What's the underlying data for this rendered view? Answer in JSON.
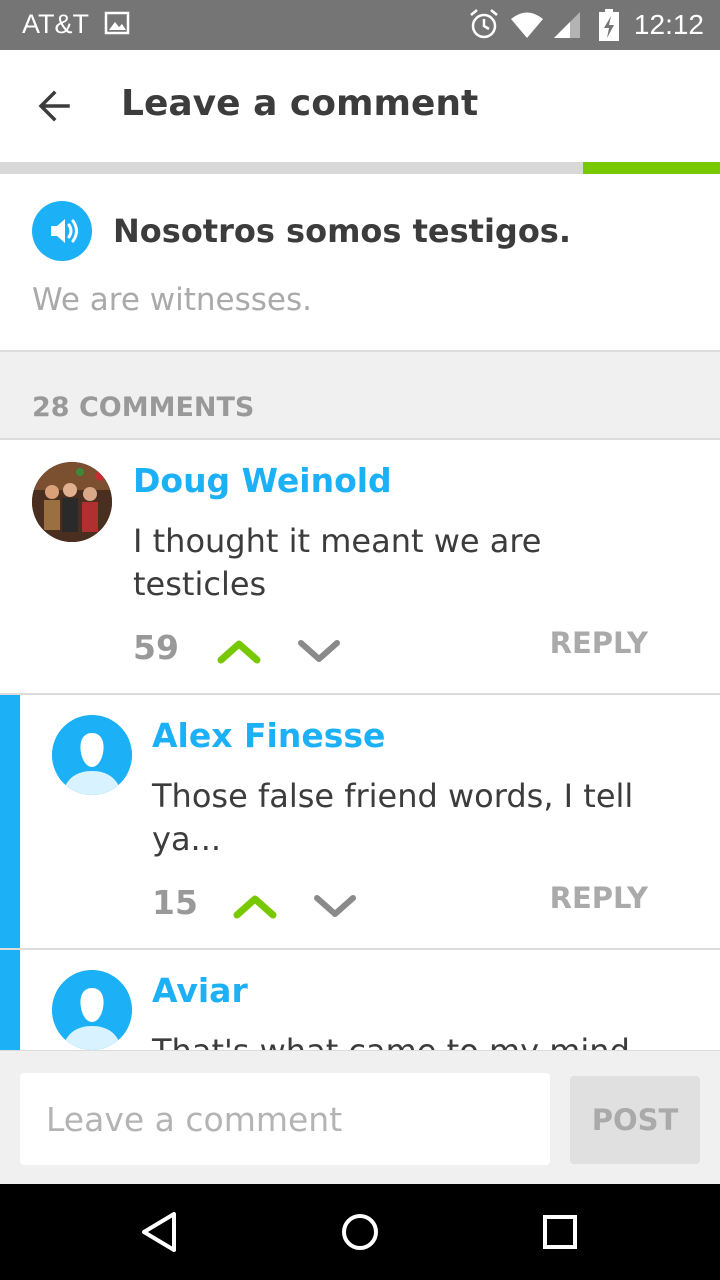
{
  "status_bar": {
    "carrier": "AT&T",
    "time": "12:12"
  },
  "header": {
    "title": "Leave a comment"
  },
  "lesson_progress": 0.19,
  "sentence": {
    "text": "Nosotros somos testigos.",
    "translation": "We are witnesses."
  },
  "comments_count": "28 COMMENTS",
  "comments": [
    {
      "author": "Doug Weinold",
      "text": "I thought it meant we are testicles",
      "votes": "59",
      "reply_label": "REPLY"
    },
    {
      "author": "Alex Finesse",
      "text": "Those false friend words, I tell ya...",
      "votes": "15",
      "reply_label": "REPLY"
    },
    {
      "author": "Aviar",
      "text": "That's what came to my mind"
    }
  ],
  "composer": {
    "placeholder": "Leave a comment",
    "post_label": "POST"
  },
  "colors": {
    "accent_blue": "#1cb0f6",
    "upvote_green": "#78c800",
    "status_bar": "#757575"
  }
}
